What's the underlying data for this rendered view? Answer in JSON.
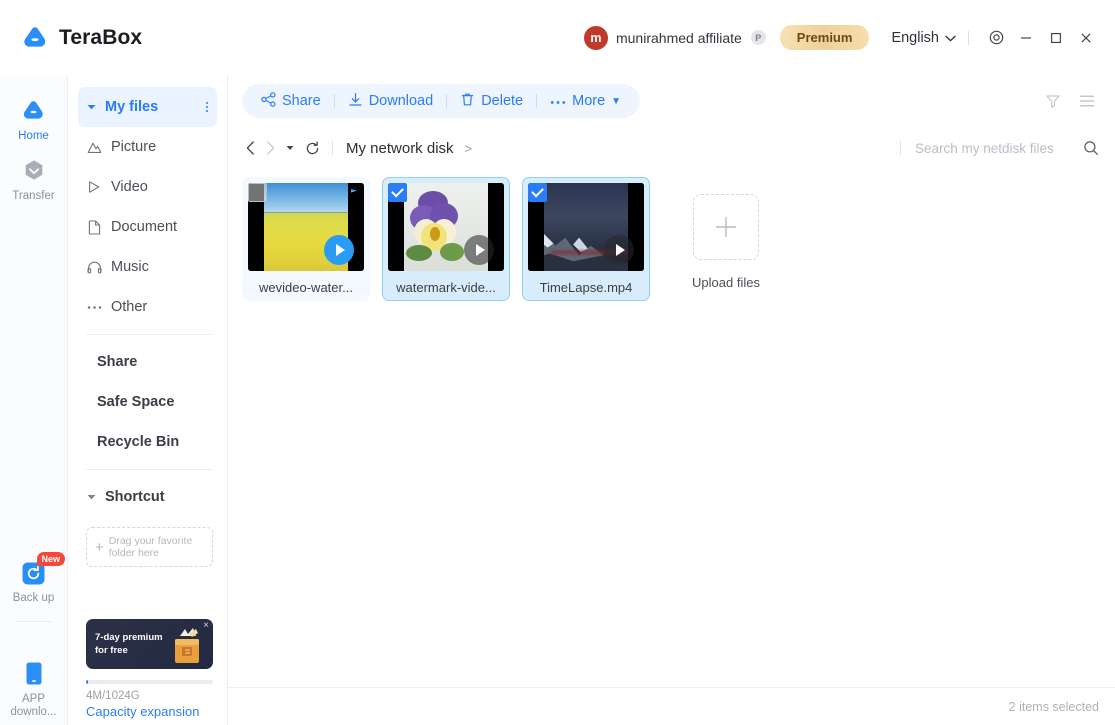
{
  "app": {
    "brand": "TeraBox",
    "brand_color": "#2a7cf7"
  },
  "titlebar": {
    "user": {
      "avatar_initial": "m",
      "name": "munirahmed affiliate",
      "badge": "P",
      "avatar_color": "#c0392b"
    },
    "premium_label": "Premium",
    "language": "English",
    "chevron": "⌄",
    "settings_icon": "gear-icon",
    "minimize_icon": "minimize-icon",
    "maximize_icon": "maximize-icon",
    "close_icon": "close-icon"
  },
  "rail": {
    "items": [
      {
        "label": "Home",
        "icon": "cloud-icon",
        "active": true,
        "badge": ""
      },
      {
        "label": "Transfer",
        "icon": "transfer-icon",
        "active": false,
        "badge": ""
      },
      {
        "label": "Back up",
        "icon": "backup-sync-icon",
        "active": false,
        "badge": "New"
      },
      {
        "label": "APP downlo...",
        "icon": "mobile-app-icon",
        "active": false,
        "badge": ""
      }
    ]
  },
  "sidebar": {
    "items": [
      {
        "label": "My files",
        "icon": "caret-down-icon",
        "active": true,
        "has_menu": true,
        "bold": true
      },
      {
        "label": "Picture",
        "icon": "picture-icon",
        "active": false,
        "has_menu": false,
        "bold": false
      },
      {
        "label": "Video",
        "icon": "video-icon",
        "active": false,
        "has_menu": false,
        "bold": false
      },
      {
        "label": "Document",
        "icon": "document-icon",
        "active": false,
        "has_menu": false,
        "bold": false
      },
      {
        "label": "Music",
        "icon": "music-icon",
        "active": false,
        "has_menu": false,
        "bold": false
      },
      {
        "label": "Other",
        "icon": "ellipsis-icon",
        "active": false,
        "has_menu": false,
        "bold": false
      }
    ],
    "links": [
      {
        "label": "Share"
      },
      {
        "label": "Safe Space"
      },
      {
        "label": "Recycle Bin"
      }
    ],
    "shortcut": {
      "label": "Shortcut",
      "dropzone_text": "Drag your favorite folder here",
      "dropzone_plus": "+"
    },
    "promo": {
      "line1": "7-day premium",
      "line2": "for free",
      "close": "×"
    },
    "storage": {
      "used_text": "4M/1024G",
      "percent": 1,
      "expand_label": "Capacity expansion"
    }
  },
  "toolbar": {
    "buttons": [
      {
        "label": "Share",
        "icon": "share-nodes-icon"
      },
      {
        "label": "Download",
        "icon": "download-icon"
      },
      {
        "label": "Delete",
        "icon": "trash-icon"
      },
      {
        "label": "More",
        "icon": "ellipsis-icon",
        "caret": "▼"
      }
    ],
    "right_icons": [
      {
        "name": "sort-filter-icon"
      },
      {
        "name": "list-view-icon"
      }
    ]
  },
  "breadcrumb": {
    "back_icon": "chevron-left-icon",
    "forward_icon": "chevron-right-icon",
    "history_caret": "▾",
    "refresh_icon": "refresh-icon",
    "path": "My network disk",
    "path_sep": ">"
  },
  "search": {
    "placeholder": "Search my netdisk files",
    "value": "",
    "icon": "search-icon"
  },
  "files": [
    {
      "name": "wevideo-water...",
      "thumb": "canola-field",
      "selected": false,
      "hovered": true,
      "play_style": "blue",
      "has_flag": true
    },
    {
      "name": "watermark-vide...",
      "thumb": "pansy-flower",
      "selected": true,
      "hovered": false,
      "play_style": "dark",
      "has_flag": false
    },
    {
      "name": "TimeLapse.mp4",
      "thumb": "mountain-timelapse",
      "selected": true,
      "hovered": false,
      "play_style": "dark",
      "has_flag": false
    }
  ],
  "upload": {
    "label": "Upload files",
    "plus": "+"
  },
  "status": {
    "selection_text": "2 items selected"
  }
}
